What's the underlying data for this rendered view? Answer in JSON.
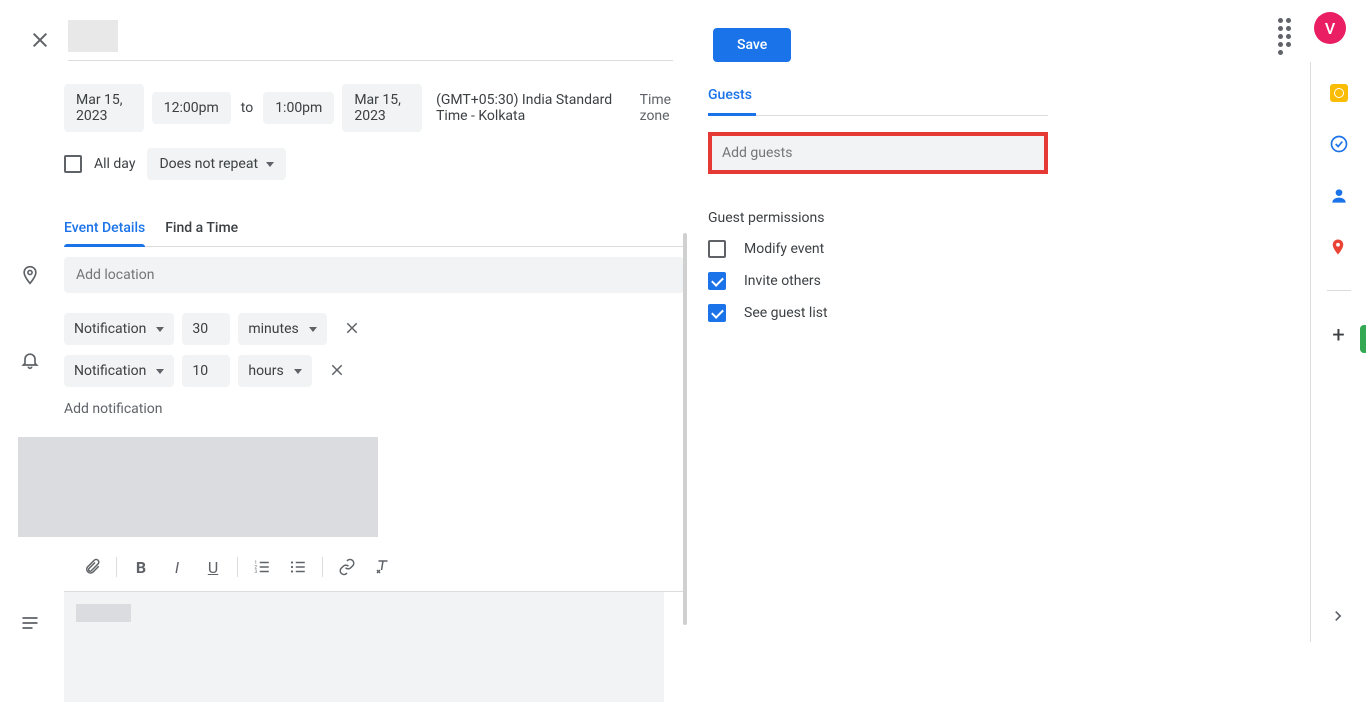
{
  "header": {
    "save_label": "Save",
    "avatar_letter": "V"
  },
  "dates": {
    "start_date": "Mar 15, 2023",
    "start_time": "12:00pm",
    "to": "to",
    "end_time": "1:00pm",
    "end_date": "Mar 15, 2023",
    "timezone": "(GMT+05:30) India Standard Time - Kolkata",
    "timezone_link": "Time zone"
  },
  "allday": {
    "label": "All day",
    "repeat": "Does not repeat"
  },
  "tabs": {
    "details": "Event Details",
    "findtime": "Find a Time"
  },
  "location": {
    "placeholder": "Add location"
  },
  "notifications": [
    {
      "type": "Notification",
      "value": "30",
      "unit": "minutes"
    },
    {
      "type": "Notification",
      "value": "10",
      "unit": "hours"
    }
  ],
  "add_notification": "Add notification",
  "guests": {
    "tab": "Guests",
    "placeholder": "Add guests",
    "permissions_title": "Guest permissions",
    "perms": [
      {
        "label": "Modify event",
        "checked": false
      },
      {
        "label": "Invite others",
        "checked": true
      },
      {
        "label": "See guest list",
        "checked": true
      }
    ]
  }
}
